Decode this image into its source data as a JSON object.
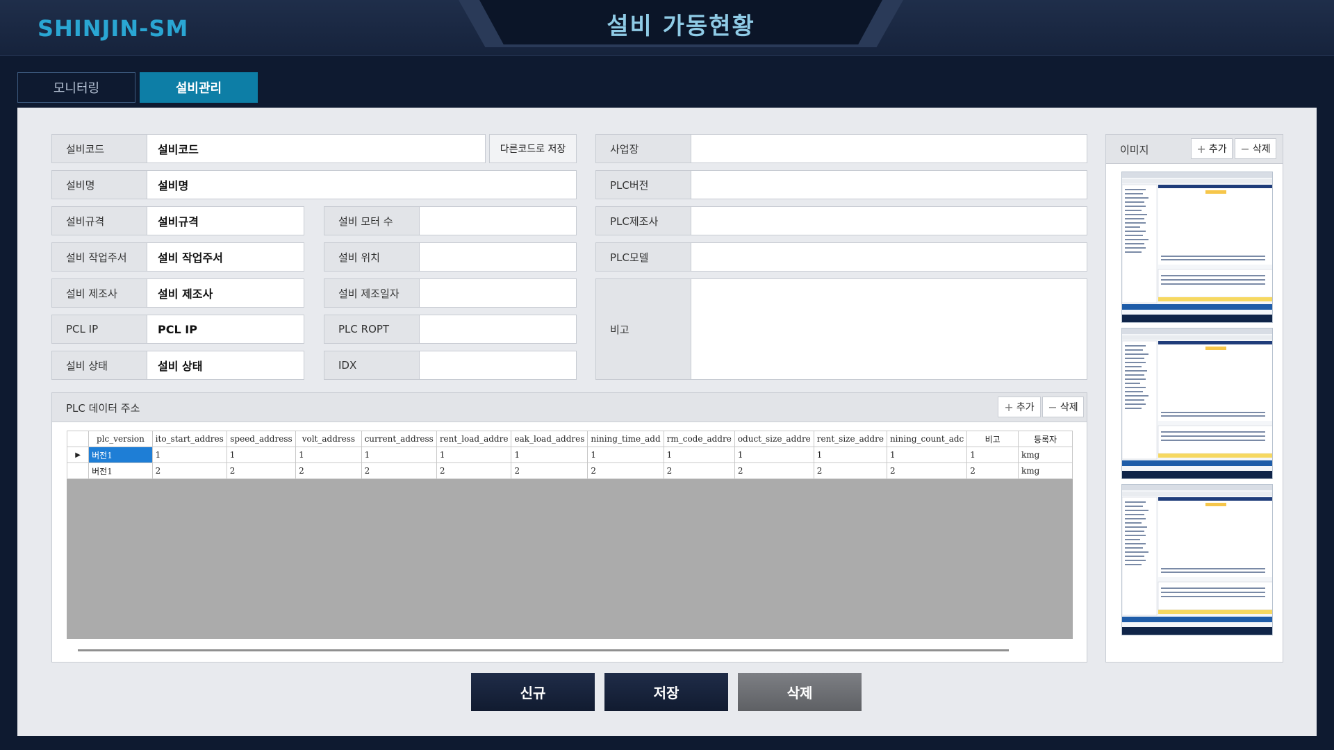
{
  "header": {
    "brand": "SHINJIN-SM",
    "title": "설비 가동현황"
  },
  "tabs": [
    {
      "label": "모니터링",
      "active": false
    },
    {
      "label": "설비관리",
      "active": true
    }
  ],
  "form": {
    "code": {
      "label": "설비코드",
      "value": "설비코드"
    },
    "save_other_code_label": "다른코드로 저장",
    "name": {
      "label": "설비명",
      "value": "설비명"
    },
    "spec": {
      "label": "설비규격",
      "value": "설비규격"
    },
    "work_address": {
      "label": "설비 작업주서",
      "value": "설비 작업주서"
    },
    "maker": {
      "label": "설비 제조사",
      "value": "설비 제조사"
    },
    "pcl_ip": {
      "label": "PCL IP",
      "value": "PCL IP"
    },
    "status": {
      "label": "설비 상태",
      "value": "설비 상태"
    },
    "motor_count": {
      "label": "설비 모터 수",
      "value": ""
    },
    "location": {
      "label": "설비 위치",
      "value": ""
    },
    "make_date": {
      "label": "설비 제조일자",
      "value": ""
    },
    "plc_ropt": {
      "label": "PLC ROPT",
      "value": ""
    },
    "idx": {
      "label": "IDX",
      "value": ""
    },
    "site": {
      "label": "사업장",
      "value": ""
    },
    "plc_version": {
      "label": "PLC버전",
      "value": ""
    },
    "plc_maker": {
      "label": "PLC제조사",
      "value": ""
    },
    "plc_model": {
      "label": "PLC모델",
      "value": ""
    },
    "memo": {
      "label": "비고",
      "value": ""
    }
  },
  "plc": {
    "title": "PLC 데이터 주소",
    "add_label": "추가",
    "delete_label": "삭제",
    "columns": [
      "plc_version",
      "ito_start_addres",
      "speed_address",
      "volt_address",
      "current_address",
      "rent_load_addre",
      "eak_load_addres",
      "nining_time_add",
      "rm_code_addre",
      "oduct_size_addre",
      "rent_size_addre",
      "nining_count_adc",
      "비고",
      "등록자"
    ],
    "rows": [
      [
        "버전1",
        "1",
        "1",
        "1",
        "1",
        "1",
        "1",
        "1",
        "1",
        "1",
        "1",
        "1",
        "1",
        "kmg"
      ],
      [
        "버전1",
        "2",
        "2",
        "2",
        "2",
        "2",
        "2",
        "2",
        "2",
        "2",
        "2",
        "2",
        "2",
        "kmg"
      ]
    ],
    "selected_row_marker": "▶"
  },
  "image_panel": {
    "title": "이미지",
    "add_label": "추가",
    "delete_label": "삭제",
    "thumbnail_count": 3
  },
  "actions": {
    "new_label": "신규",
    "save_label": "저장",
    "delete_label": "삭제"
  },
  "colors": {
    "accent": "#0d7ea6",
    "brand": "#2aa6d3",
    "title": "#8fcbe6",
    "selection": "#1e7ed6"
  }
}
